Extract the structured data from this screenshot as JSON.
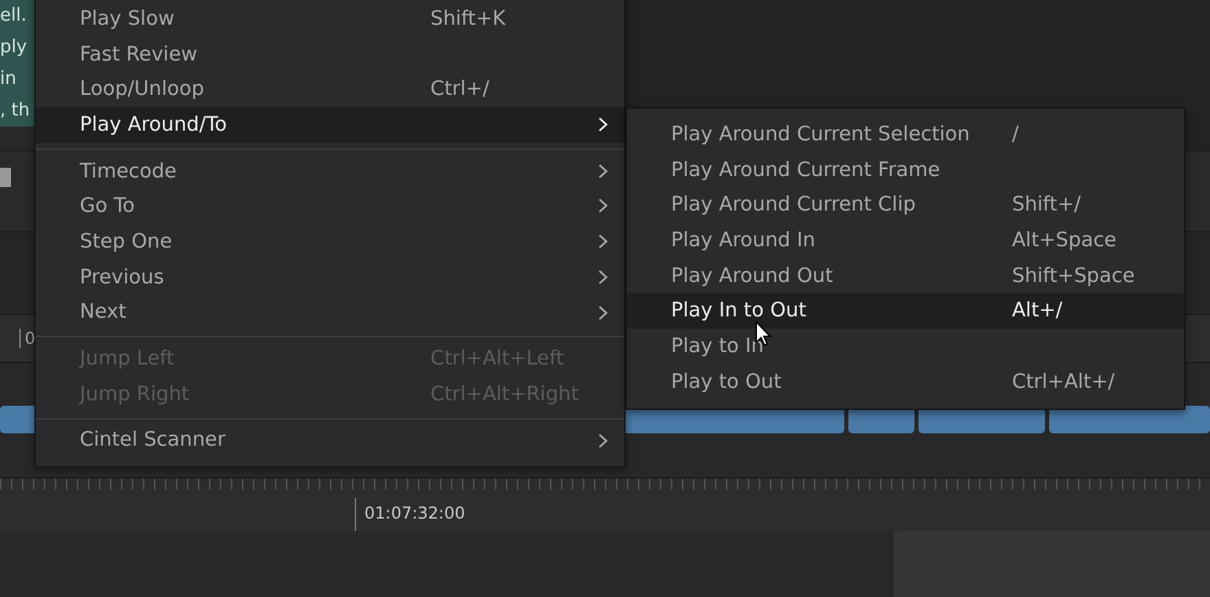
{
  "background_text": [
    "ell.",
    "ply",
    "in",
    ", th"
  ],
  "ruler_label": "0",
  "timeline": {
    "timecode": "01:07:32:00"
  },
  "menu": {
    "items": [
      {
        "kind": "item",
        "label": "Play Slow",
        "shortcut": "Shift+K",
        "submenu": false,
        "disabled": false,
        "selected": false
      },
      {
        "kind": "item",
        "label": "Fast Review",
        "submenu": false,
        "disabled": false,
        "selected": false
      },
      {
        "kind": "item",
        "label": "Loop/Unloop",
        "shortcut": "Ctrl+/",
        "submenu": false,
        "disabled": false,
        "selected": false
      },
      {
        "kind": "item",
        "label": "Play Around/To",
        "submenu": true,
        "disabled": false,
        "selected": true
      },
      {
        "kind": "separator"
      },
      {
        "kind": "item",
        "label": "Timecode",
        "submenu": true,
        "disabled": false,
        "selected": false
      },
      {
        "kind": "item",
        "label": "Go To",
        "submenu": true,
        "disabled": false,
        "selected": false
      },
      {
        "kind": "item",
        "label": "Step One",
        "submenu": true,
        "disabled": false,
        "selected": false
      },
      {
        "kind": "item",
        "label": "Previous",
        "submenu": true,
        "disabled": false,
        "selected": false
      },
      {
        "kind": "item",
        "label": "Next",
        "submenu": true,
        "disabled": false,
        "selected": false
      },
      {
        "kind": "separator"
      },
      {
        "kind": "item",
        "label": "Jump Left",
        "shortcut": "Ctrl+Alt+Left",
        "submenu": false,
        "disabled": true,
        "selected": false
      },
      {
        "kind": "item",
        "label": "Jump Right",
        "shortcut": "Ctrl+Alt+Right",
        "submenu": false,
        "disabled": true,
        "selected": false
      },
      {
        "kind": "separator"
      },
      {
        "kind": "item",
        "label": "Cintel Scanner",
        "submenu": true,
        "disabled": false,
        "selected": false
      }
    ]
  },
  "submenu": {
    "items": [
      {
        "kind": "item",
        "label": "Play Around Current Selection",
        "shortcut": "/",
        "submenu": false,
        "disabled": false,
        "selected": false
      },
      {
        "kind": "item",
        "label": "Play Around Current Frame",
        "submenu": false,
        "disabled": false,
        "selected": false
      },
      {
        "kind": "item",
        "label": "Play Around Current Clip",
        "shortcut": "Shift+/",
        "submenu": false,
        "disabled": false,
        "selected": false
      },
      {
        "kind": "item",
        "label": "Play Around In",
        "shortcut": "Alt+Space",
        "submenu": false,
        "disabled": false,
        "selected": false
      },
      {
        "kind": "item",
        "label": "Play Around Out",
        "shortcut": "Shift+Space",
        "submenu": false,
        "disabled": false,
        "selected": false
      },
      {
        "kind": "item",
        "label": "Play In to Out",
        "shortcut": "Alt+/",
        "submenu": false,
        "disabled": false,
        "selected": true
      },
      {
        "kind": "item",
        "label": "Play to In",
        "submenu": false,
        "disabled": false,
        "selected": false
      },
      {
        "kind": "item",
        "label": "Play to Out",
        "shortcut": "Ctrl+Alt+/",
        "submenu": false,
        "disabled": false,
        "selected": false
      }
    ]
  }
}
